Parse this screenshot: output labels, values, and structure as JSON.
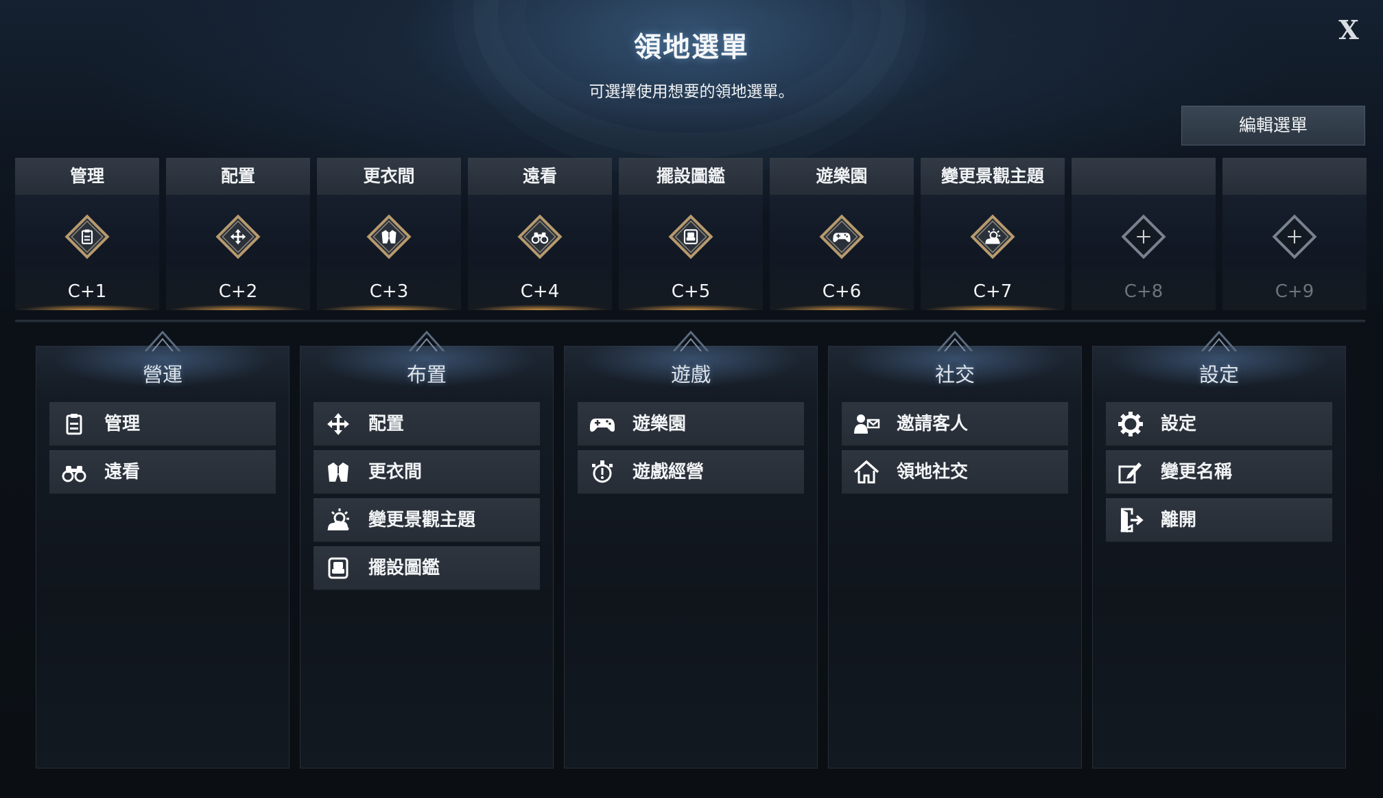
{
  "window": {
    "title": "領地選單",
    "subtitle": "可選擇使用想要的領地選單。",
    "close_label": "X",
    "edit_button_label": "編輯選單"
  },
  "hotkey_slots": [
    {
      "label": "管理",
      "key": "C+1",
      "icon": "clipboard-icon"
    },
    {
      "label": "配置",
      "key": "C+2",
      "icon": "move-arrows-icon"
    },
    {
      "label": "更衣間",
      "key": "C+3",
      "icon": "jacket-icon"
    },
    {
      "label": "遠看",
      "key": "C+4",
      "icon": "binoculars-icon"
    },
    {
      "label": "擺設圖鑑",
      "key": "C+5",
      "icon": "armchair-icon"
    },
    {
      "label": "遊樂園",
      "key": "C+6",
      "icon": "gamepad-icon"
    },
    {
      "label": "變更景觀主題",
      "key": "C+7",
      "icon": "weather-sun-icon"
    },
    {
      "label": "",
      "key": "C+8",
      "icon": "plus-icon"
    },
    {
      "label": "",
      "key": "C+9",
      "icon": "plus-icon"
    }
  ],
  "categories": [
    {
      "title": "營運",
      "items": [
        {
          "label": "管理",
          "icon": "clipboard-icon"
        },
        {
          "label": "遠看",
          "icon": "binoculars-icon"
        }
      ]
    },
    {
      "title": "布置",
      "items": [
        {
          "label": "配置",
          "icon": "move-arrows-icon"
        },
        {
          "label": "更衣間",
          "icon": "jacket-icon"
        },
        {
          "label": "變更景觀主題",
          "icon": "weather-sun-icon"
        },
        {
          "label": "擺設圖鑑",
          "icon": "armchair-icon"
        }
      ]
    },
    {
      "title": "遊戲",
      "items": [
        {
          "label": "遊樂園",
          "icon": "gamepad-icon"
        },
        {
          "label": "遊戲經營",
          "icon": "game-manage-icon"
        }
      ]
    },
    {
      "title": "社交",
      "items": [
        {
          "label": "邀請客人",
          "icon": "invite-guest-icon"
        },
        {
          "label": "領地社交",
          "icon": "house-icon"
        }
      ]
    },
    {
      "title": "設定",
      "items": [
        {
          "label": "設定",
          "icon": "gear-icon"
        },
        {
          "label": "變更名稱",
          "icon": "edit-name-icon"
        },
        {
          "label": "離開",
          "icon": "exit-door-icon"
        }
      ]
    }
  ],
  "colors": {
    "slot_glow": "#e6a046",
    "diamond_fill": "#b79a6e",
    "item_bg": "#2e353f",
    "panel_bg": "#141b24"
  }
}
